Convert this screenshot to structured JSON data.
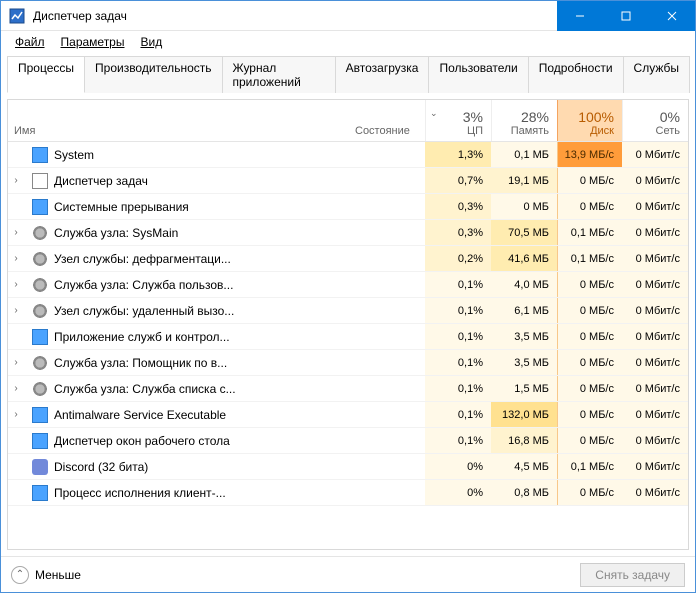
{
  "window": {
    "title": "Диспетчер задач"
  },
  "menu": {
    "file": "Файл",
    "options": "Параметры",
    "view": "Вид"
  },
  "tabs": {
    "processes": "Процессы",
    "performance": "Производительность",
    "app_history": "Журнал приложений",
    "startup": "Автозагрузка",
    "users": "Пользователи",
    "details": "Подробности",
    "services": "Службы"
  },
  "headers": {
    "name": "Имя",
    "state": "Состояние",
    "cpu_pct": "3%",
    "cpu": "ЦП",
    "mem_pct": "28%",
    "mem": "Память",
    "disk_pct": "100%",
    "disk": "Диск",
    "net_pct": "0%",
    "net": "Сеть"
  },
  "rows": [
    {
      "exp": "",
      "ic": "ic-blue",
      "name": "System",
      "cpu": "1,3%",
      "cpu_h": "h2",
      "mem": "0,1 МБ",
      "mem_h": "h0",
      "disk": "13,9 МБ/с",
      "disk_h": "hd",
      "net": "0 Мбит/с"
    },
    {
      "exp": "›",
      "ic": "ic-tm",
      "name": "Диспетчер задач",
      "cpu": "0,7%",
      "cpu_h": "h1",
      "mem": "19,1 МБ",
      "mem_h": "h1",
      "disk": "0 МБ/с",
      "disk_h": "h0",
      "net": "0 Мбит/с"
    },
    {
      "exp": "",
      "ic": "ic-blue",
      "name": "Системные прерывания",
      "cpu": "0,3%",
      "cpu_h": "h1",
      "mem": "0 МБ",
      "mem_h": "h0",
      "disk": "0 МБ/с",
      "disk_h": "h0",
      "net": "0 Мбит/с"
    },
    {
      "exp": "›",
      "ic": "ic-gear",
      "name": "Служба узла: SysMain",
      "cpu": "0,3%",
      "cpu_h": "h1",
      "mem": "70,5 МБ",
      "mem_h": "h2",
      "disk": "0,1 МБ/с",
      "disk_h": "h0",
      "net": "0 Мбит/с"
    },
    {
      "exp": "›",
      "ic": "ic-gear",
      "name": "Узел службы: дефрагментаци...",
      "cpu": "0,2%",
      "cpu_h": "h1",
      "mem": "41,6 МБ",
      "mem_h": "h2",
      "disk": "0,1 МБ/с",
      "disk_h": "h0",
      "net": "0 Мбит/с"
    },
    {
      "exp": "›",
      "ic": "ic-gear",
      "name": "Служба узла: Служба пользов...",
      "cpu": "0,1%",
      "cpu_h": "h0",
      "mem": "4,0 МБ",
      "mem_h": "h0",
      "disk": "0 МБ/с",
      "disk_h": "h0",
      "net": "0 Мбит/с"
    },
    {
      "exp": "›",
      "ic": "ic-gear",
      "name": "Узел службы: удаленный вызо...",
      "cpu": "0,1%",
      "cpu_h": "h0",
      "mem": "6,1 МБ",
      "mem_h": "h0",
      "disk": "0 МБ/с",
      "disk_h": "h0",
      "net": "0 Мбит/с"
    },
    {
      "exp": "",
      "ic": "ic-blue",
      "name": "Приложение служб и контрол...",
      "cpu": "0,1%",
      "cpu_h": "h0",
      "mem": "3,5 МБ",
      "mem_h": "h0",
      "disk": "0 МБ/с",
      "disk_h": "h0",
      "net": "0 Мбит/с"
    },
    {
      "exp": "›",
      "ic": "ic-gear",
      "name": "Служба узла: Помощник по в...",
      "cpu": "0,1%",
      "cpu_h": "h0",
      "mem": "3,5 МБ",
      "mem_h": "h0",
      "disk": "0 МБ/с",
      "disk_h": "h0",
      "net": "0 Мбит/с"
    },
    {
      "exp": "›",
      "ic": "ic-gear",
      "name": "Служба узла: Служба списка с...",
      "cpu": "0,1%",
      "cpu_h": "h0",
      "mem": "1,5 МБ",
      "mem_h": "h0",
      "disk": "0 МБ/с",
      "disk_h": "h0",
      "net": "0 Мбит/с"
    },
    {
      "exp": "›",
      "ic": "ic-blue",
      "name": "Antimalware Service Executable",
      "cpu": "0,1%",
      "cpu_h": "h0",
      "mem": "132,0 МБ",
      "mem_h": "h3",
      "disk": "0 МБ/с",
      "disk_h": "h0",
      "net": "0 Мбит/с"
    },
    {
      "exp": "",
      "ic": "ic-blue",
      "name": "Диспетчер окон рабочего стола",
      "cpu": "0,1%",
      "cpu_h": "h0",
      "mem": "16,8 МБ",
      "mem_h": "h1",
      "disk": "0 МБ/с",
      "disk_h": "h0",
      "net": "0 Мбит/с"
    },
    {
      "exp": "",
      "ic": "ic-disc",
      "name": "Discord (32 бита)",
      "cpu": "0%",
      "cpu_h": "h0",
      "mem": "4,5 МБ",
      "mem_h": "h0",
      "disk": "0,1 МБ/с",
      "disk_h": "h0",
      "net": "0 Мбит/с"
    },
    {
      "exp": "",
      "ic": "ic-blue",
      "name": "Процесс исполнения клиент-...",
      "cpu": "0%",
      "cpu_h": "h0",
      "mem": "0,8 МБ",
      "mem_h": "h0",
      "disk": "0 МБ/с",
      "disk_h": "h0",
      "net": "0 Мбит/с"
    }
  ],
  "footer": {
    "fewer": "Меньше",
    "end_task": "Снять задачу"
  }
}
